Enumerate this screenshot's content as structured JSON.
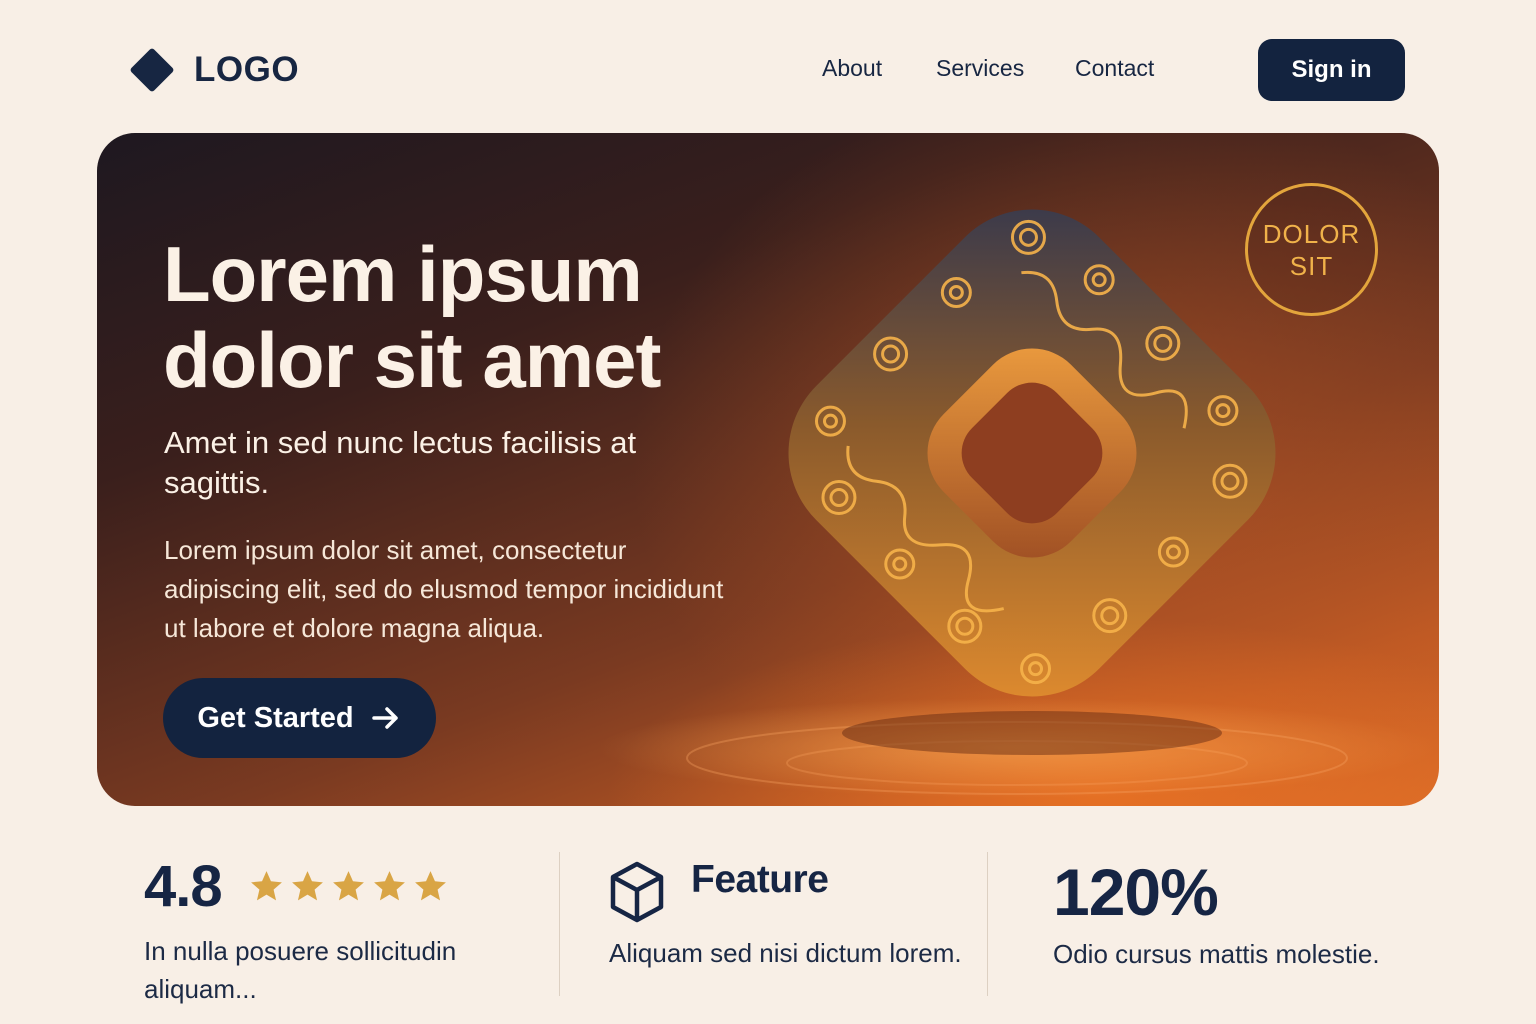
{
  "nav": {
    "logo_text": "LOGO",
    "links": [
      "About",
      "Services",
      "Contact"
    ],
    "signin_label": "Sign in"
  },
  "hero": {
    "title_line1": "Lorem ipsum",
    "title_line2": "dolor sit amet",
    "subtitle": "Amet in sed nunc lectus facilisis at sagittis.",
    "body": "Lorem ipsum dolor sit amet, consectetur adipiscing elit, sed do elusmod tempor incididunt ut labore et dolore magna aliqua.",
    "cta_label": "Get Started",
    "badge_line1": "DOLOR",
    "badge_line2": "SIT"
  },
  "stats": {
    "rating_value": "4.8",
    "rating_stars": 5,
    "rating_text": "In nulla posuere sollicitudin aliquam...",
    "feature_title": "Feature",
    "feature_text": "Aliquam sed nisi dictum lorem.",
    "percent_value": "120%",
    "percent_text": "Odio cursus mattis molestie."
  },
  "colors": {
    "background": "#f8efe6",
    "navy": "#13233f",
    "accent_gold": "#e3a53c",
    "hero_orange": "#d86a28"
  },
  "icons": [
    "diamond-logo-icon",
    "arrow-right-icon",
    "star-icon",
    "cube-icon"
  ]
}
